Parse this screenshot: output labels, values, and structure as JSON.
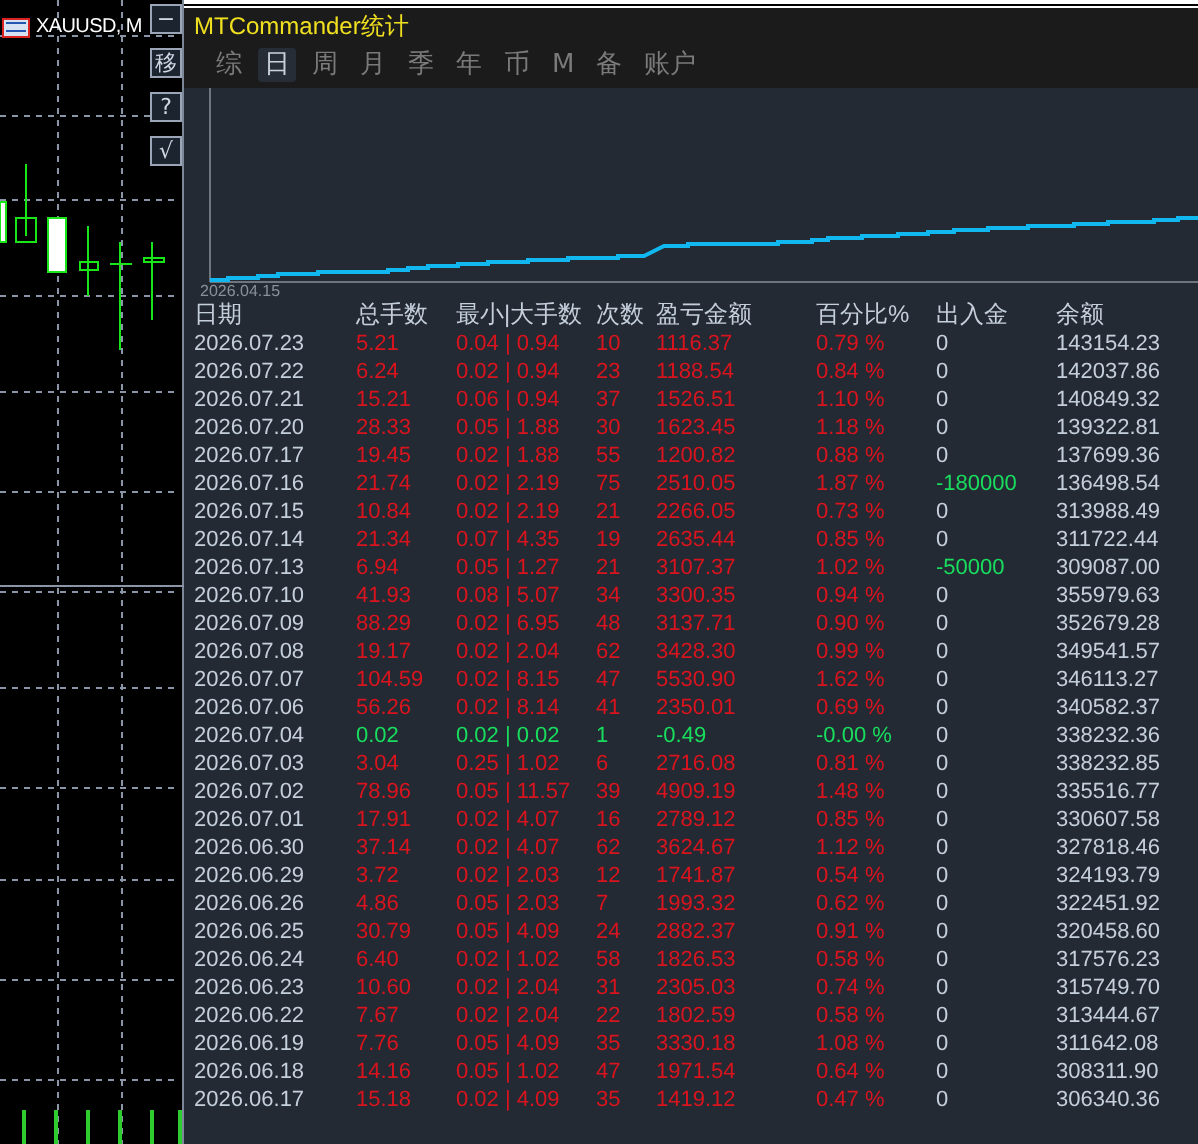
{
  "chart_window": {
    "title": "XAUUSD, M",
    "buttons": [
      {
        "label": "−"
      },
      {
        "label": "移"
      },
      {
        "label": "?"
      },
      {
        "label": "√"
      }
    ]
  },
  "panel": {
    "title": "MTCommander统计",
    "tabs": [
      {
        "label": "综",
        "selected": false
      },
      {
        "label": "日",
        "selected": true
      },
      {
        "label": "周",
        "selected": false
      },
      {
        "label": "月",
        "selected": false
      },
      {
        "label": "季",
        "selected": false
      },
      {
        "label": "年",
        "selected": false
      },
      {
        "label": "币",
        "selected": false
      },
      {
        "label": "M",
        "selected": false
      },
      {
        "label": "备",
        "selected": false
      },
      {
        "label": "账户",
        "selected": false
      }
    ],
    "equity_chart": {
      "start_label": "2026.04.15"
    },
    "table": {
      "columns": [
        "日期",
        "总手数",
        "最小|大手数",
        "次数",
        "盈亏金额",
        "百分比%",
        "出入金",
        "余额"
      ],
      "rows": [
        {
          "kind": "gain",
          "flow_highlight": false,
          "cells": [
            "2026.07.23",
            "5.21",
            "0.04 | 0.94",
            "10",
            "1116.37",
            "0.79 %",
            "0",
            "143154.23"
          ]
        },
        {
          "kind": "gain",
          "flow_highlight": false,
          "cells": [
            "2026.07.22",
            "6.24",
            "0.02 | 0.94",
            "23",
            "1188.54",
            "0.84 %",
            "0",
            "142037.86"
          ]
        },
        {
          "kind": "gain",
          "flow_highlight": false,
          "cells": [
            "2026.07.21",
            "15.21",
            "0.06 | 0.94",
            "37",
            "1526.51",
            "1.10 %",
            "0",
            "140849.32"
          ]
        },
        {
          "kind": "gain",
          "flow_highlight": false,
          "cells": [
            "2026.07.20",
            "28.33",
            "0.05 | 1.88",
            "30",
            "1623.45",
            "1.18 %",
            "0",
            "139322.81"
          ]
        },
        {
          "kind": "gain",
          "flow_highlight": false,
          "cells": [
            "2026.07.17",
            "19.45",
            "0.02 | 1.88",
            "55",
            "1200.82",
            "0.88 %",
            "0",
            "137699.36"
          ]
        },
        {
          "kind": "gain",
          "flow_highlight": true,
          "cells": [
            "2026.07.16",
            "21.74",
            "0.02 | 2.19",
            "75",
            "2510.05",
            "1.87 %",
            "-180000",
            "136498.54"
          ]
        },
        {
          "kind": "gain",
          "flow_highlight": false,
          "cells": [
            "2026.07.15",
            "10.84",
            "0.02 | 2.19",
            "21",
            "2266.05",
            "0.73 %",
            "0",
            "313988.49"
          ]
        },
        {
          "kind": "gain",
          "flow_highlight": false,
          "cells": [
            "2026.07.14",
            "21.34",
            "0.07 | 4.35",
            "19",
            "2635.44",
            "0.85 %",
            "0",
            "311722.44"
          ]
        },
        {
          "kind": "gain",
          "flow_highlight": true,
          "cells": [
            "2026.07.13",
            "6.94",
            "0.05 | 1.27",
            "21",
            "3107.37",
            "1.02 %",
            "-50000",
            "309087.00"
          ]
        },
        {
          "kind": "gain",
          "flow_highlight": false,
          "cells": [
            "2026.07.10",
            "41.93",
            "0.08 | 5.07",
            "34",
            "3300.35",
            "0.94 %",
            "0",
            "355979.63"
          ]
        },
        {
          "kind": "gain",
          "flow_highlight": false,
          "cells": [
            "2026.07.09",
            "88.29",
            "0.02 | 6.95",
            "48",
            "3137.71",
            "0.90 %",
            "0",
            "352679.28"
          ]
        },
        {
          "kind": "gain",
          "flow_highlight": false,
          "cells": [
            "2026.07.08",
            "19.17",
            "0.02 | 2.04",
            "62",
            "3428.30",
            "0.99 %",
            "0",
            "349541.57"
          ]
        },
        {
          "kind": "gain",
          "flow_highlight": false,
          "cells": [
            "2026.07.07",
            "104.59",
            "0.02 | 8.15",
            "47",
            "5530.90",
            "1.62 %",
            "0",
            "346113.27"
          ]
        },
        {
          "kind": "gain",
          "flow_highlight": false,
          "cells": [
            "2026.07.06",
            "56.26",
            "0.02 | 8.14",
            "41",
            "2350.01",
            "0.69 %",
            "0",
            "340582.37"
          ]
        },
        {
          "kind": "loss",
          "flow_highlight": false,
          "cells": [
            "2026.07.04",
            "0.02",
            "0.02 | 0.02",
            "1",
            "-0.49",
            "-0.00 %",
            "0",
            "338232.36"
          ]
        },
        {
          "kind": "gain",
          "flow_highlight": false,
          "cells": [
            "2026.07.03",
            "3.04",
            "0.25 | 1.02",
            "6",
            "2716.08",
            "0.81 %",
            "0",
            "338232.85"
          ]
        },
        {
          "kind": "gain",
          "flow_highlight": false,
          "cells": [
            "2026.07.02",
            "78.96",
            "0.05 | 11.57",
            "39",
            "4909.19",
            "1.48 %",
            "0",
            "335516.77"
          ]
        },
        {
          "kind": "gain",
          "flow_highlight": false,
          "cells": [
            "2026.07.01",
            "17.91",
            "0.02 | 4.07",
            "16",
            "2789.12",
            "0.85 %",
            "0",
            "330607.58"
          ]
        },
        {
          "kind": "gain",
          "flow_highlight": false,
          "cells": [
            "2026.06.30",
            "37.14",
            "0.02 | 4.07",
            "62",
            "3624.67",
            "1.12 %",
            "0",
            "327818.46"
          ]
        },
        {
          "kind": "gain",
          "flow_highlight": false,
          "cells": [
            "2026.06.29",
            "3.72",
            "0.02 | 2.03",
            "12",
            "1741.87",
            "0.54 %",
            "0",
            "324193.79"
          ]
        },
        {
          "kind": "gain",
          "flow_highlight": false,
          "cells": [
            "2026.06.26",
            "4.86",
            "0.05 | 2.03",
            "7",
            "1993.32",
            "0.62 %",
            "0",
            "322451.92"
          ]
        },
        {
          "kind": "gain",
          "flow_highlight": false,
          "cells": [
            "2026.06.25",
            "30.79",
            "0.05 | 4.09",
            "24",
            "2882.37",
            "0.91 %",
            "0",
            "320458.60"
          ]
        },
        {
          "kind": "gain",
          "flow_highlight": false,
          "cells": [
            "2026.06.24",
            "6.40",
            "0.02 | 1.02",
            "58",
            "1826.53",
            "0.58 %",
            "0",
            "317576.23"
          ]
        },
        {
          "kind": "gain",
          "flow_highlight": false,
          "cells": [
            "2026.06.23",
            "10.60",
            "0.02 | 2.04",
            "31",
            "2305.03",
            "0.74 %",
            "0",
            "315749.70"
          ]
        },
        {
          "kind": "gain",
          "flow_highlight": false,
          "cells": [
            "2026.06.22",
            "7.67",
            "0.02 | 2.04",
            "22",
            "1802.59",
            "0.58 %",
            "0",
            "313444.67"
          ]
        },
        {
          "kind": "gain",
          "flow_highlight": false,
          "cells": [
            "2026.06.19",
            "7.76",
            "0.05 | 4.09",
            "35",
            "3330.18",
            "1.08 %",
            "0",
            "311642.08"
          ]
        },
        {
          "kind": "gain",
          "flow_highlight": false,
          "cells": [
            "2026.06.18",
            "14.16",
            "0.05 | 1.02",
            "47",
            "1971.54",
            "0.64 %",
            "0",
            "308311.90"
          ]
        },
        {
          "kind": "gain",
          "flow_highlight": false,
          "cells": [
            "2026.06.17",
            "15.18",
            "0.02 | 4.09",
            "35",
            "1419.12",
            "0.47 %",
            "0",
            "306340.36"
          ]
        }
      ]
    }
  }
}
